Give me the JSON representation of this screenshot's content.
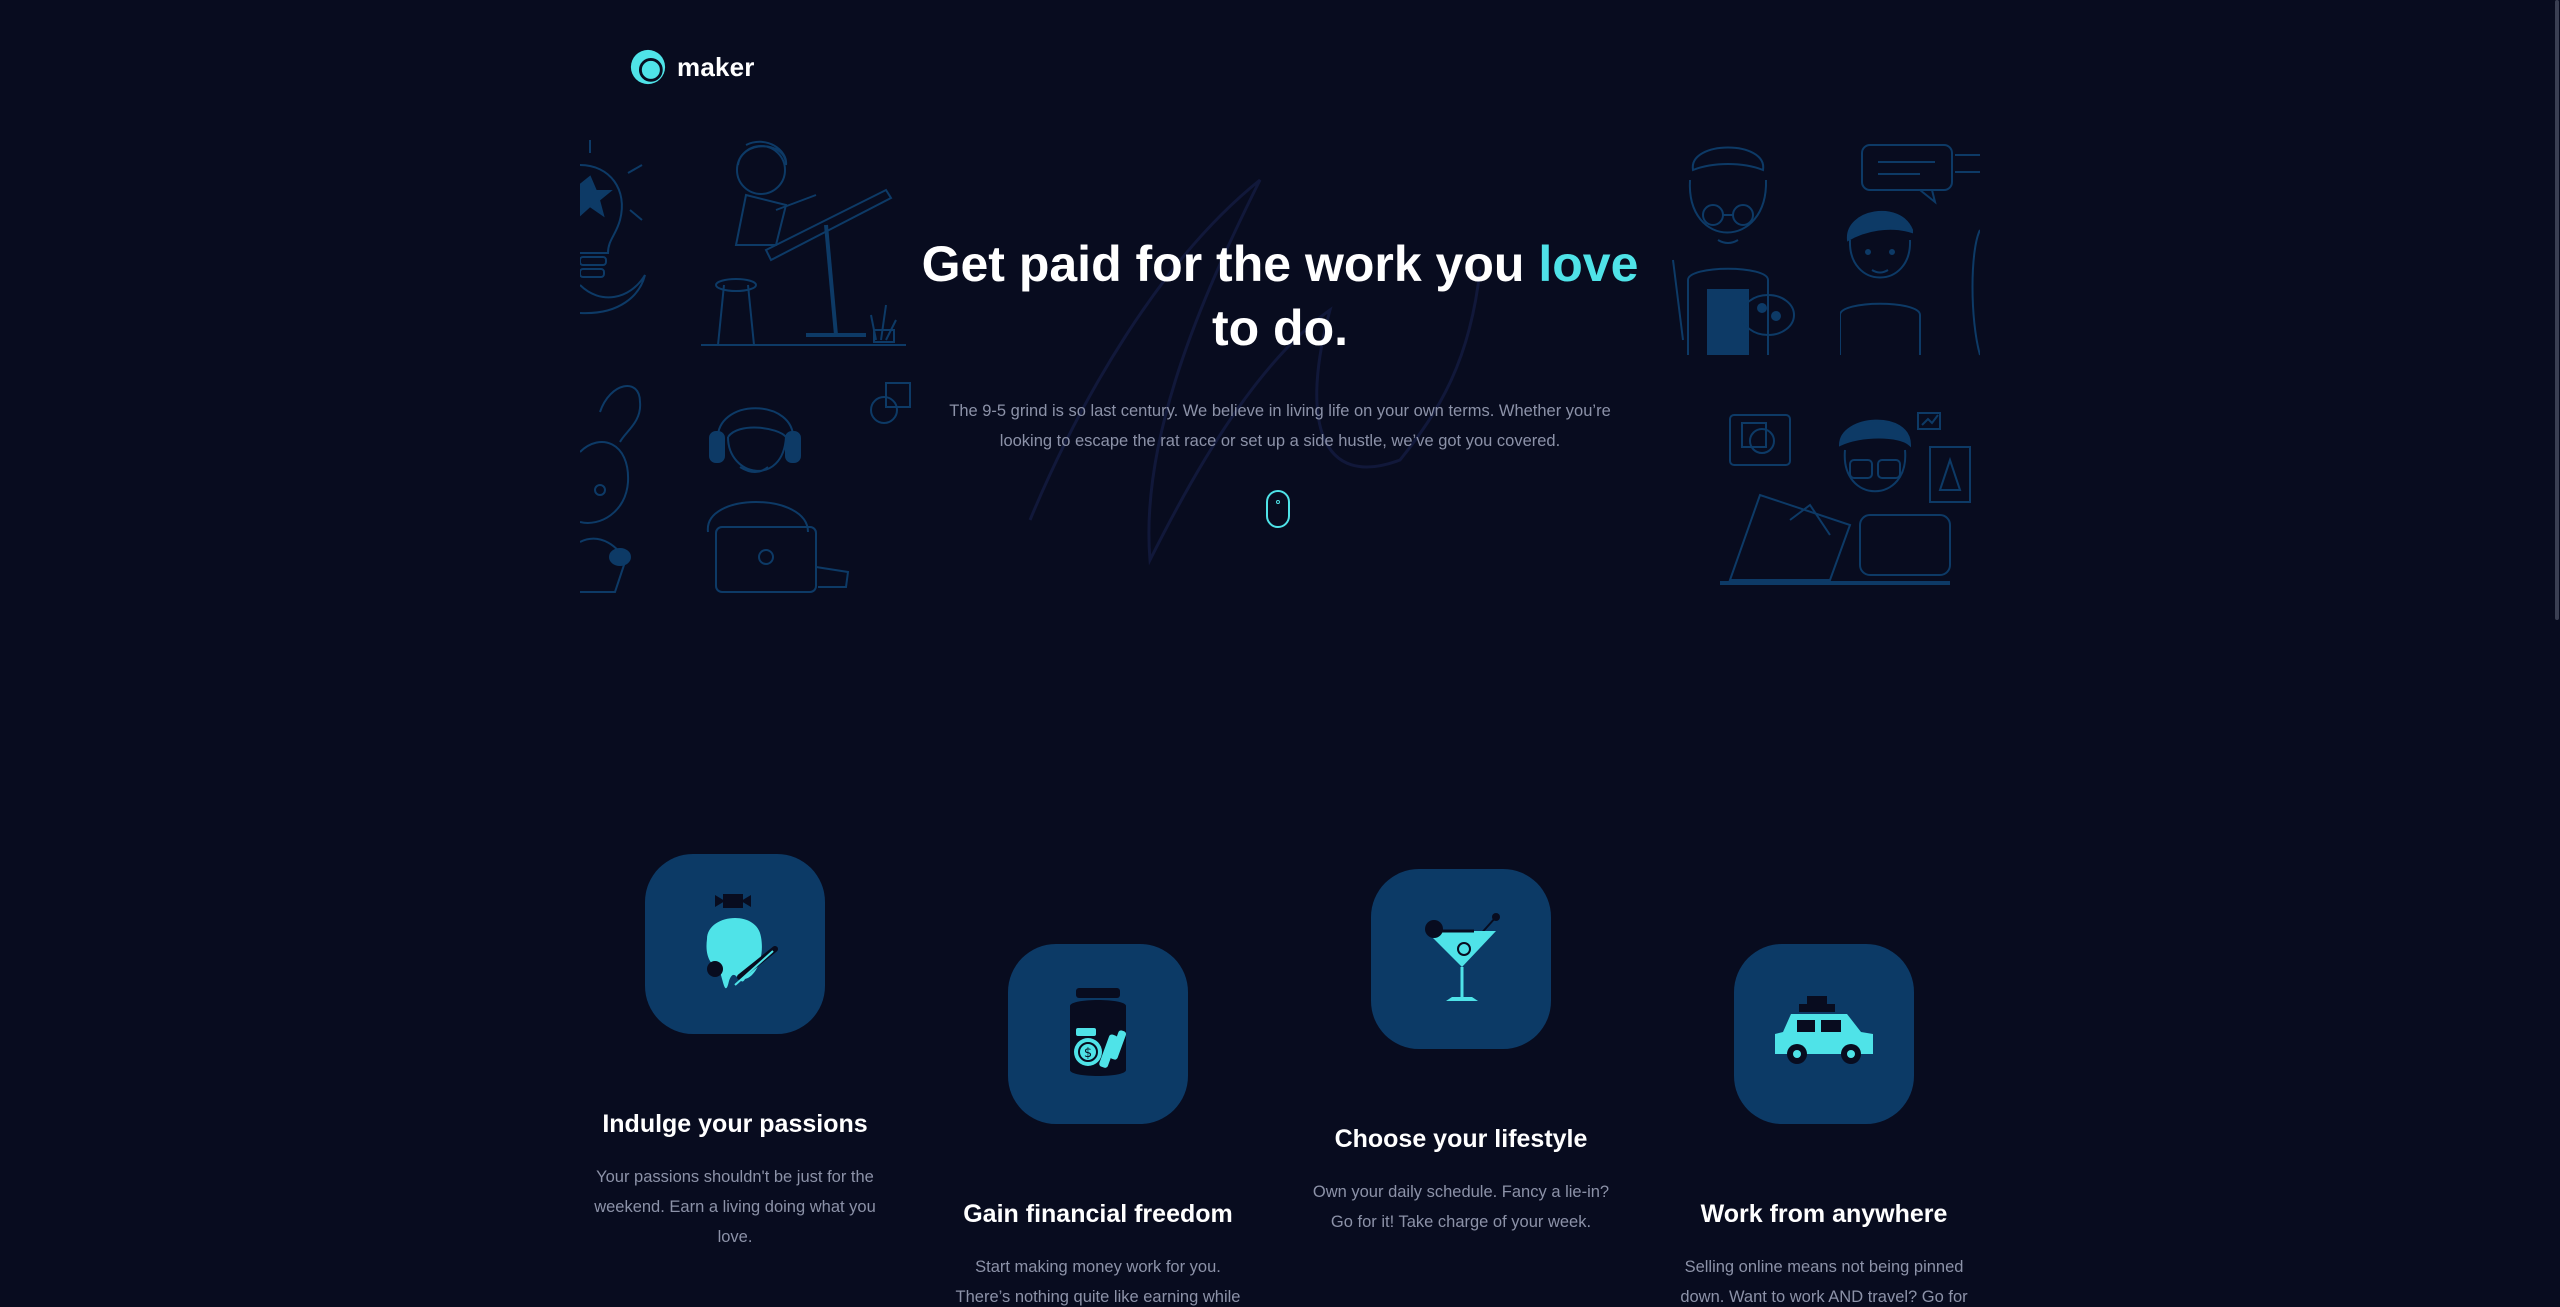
{
  "brand": {
    "name": "maker",
    "logo_icon": "maker-logo-icon",
    "accent_color": "#4fe3e8",
    "background_color": "#080c1f",
    "card_color": "#0c3a66"
  },
  "hero": {
    "title_part1": "Get paid for the work you ",
    "title_accent": "love",
    "title_part2": "to do.",
    "subtitle": "The 9-5 grind is so last century. We believe in living life on your own terms. Whether you’re looking to escape the rat race or set up a side hustle, we’ve got you covered.",
    "scroll_icon": "mouse-scroll-icon",
    "illustrations": [
      "lightbulb-star-illustration",
      "drafting-table-artist-illustration",
      "rabbit-ears-person-illustration",
      "headset-laptop-person-illustration",
      "painter-with-palette-illustration",
      "speech-bubble-man-illustration",
      "designer-at-drawing-tablet-illustration"
    ]
  },
  "features": [
    {
      "icon": "paint-bucket-icon",
      "title": "Indulge your passions",
      "description": "Your passions shouldn't be just for the weekend. Earn a living doing what you love."
    },
    {
      "icon": "money-jar-icon",
      "title": "Gain financial freedom",
      "description": "Start making money work for you. There’s nothing quite like earning while you sleep."
    },
    {
      "icon": "cocktail-glass-icon",
      "title": "Choose your lifestyle",
      "description": "Own your daily schedule. Fancy a lie-in? Go for it! Take charge of your week."
    },
    {
      "icon": "car-with-luggage-icon",
      "title": "Work from anywhere",
      "description": "Selling online means not being pinned down. Want to work AND travel? Go for it!"
    }
  ]
}
